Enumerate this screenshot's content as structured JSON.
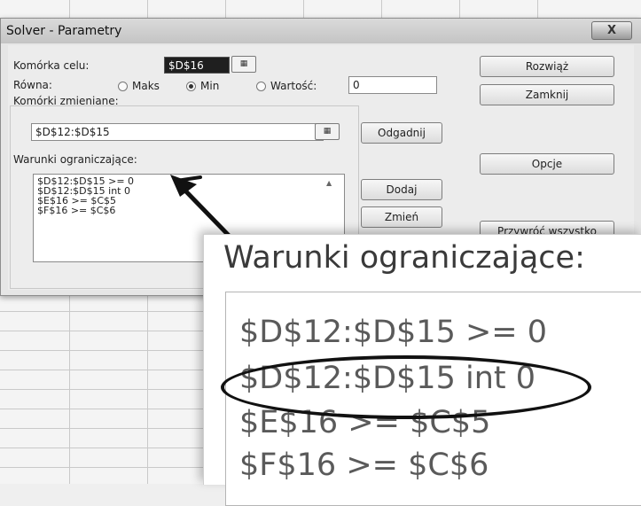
{
  "dialog": {
    "title": "Solver - Parametry",
    "close_label": "X"
  },
  "target": {
    "label": "Komórka celu:",
    "value": "$D$16"
  },
  "equal": {
    "label": "Równa:",
    "options": [
      "Maks",
      "Min",
      "Wartość:"
    ],
    "selected": "Min",
    "value": "0"
  },
  "changing": {
    "label": "Komórki zmieniane:",
    "value": "$D$12:$D$15"
  },
  "constraints": {
    "label": "Warunki ograniczające:",
    "items": [
      "$D$12:$D$15 >= 0",
      "$D$12:$D$15 int 0",
      "$E$16 >= $C$5",
      "$F$16 >= $C$6"
    ]
  },
  "buttons": {
    "solve": "Rozwiąż",
    "close": "Zamknij",
    "guess": "Odgadnij",
    "options": "Opcje",
    "add": "Dodaj",
    "change": "Zmień",
    "reset": "Przywróć wszystko"
  },
  "zoom": {
    "heading": "Warunki ograniczające:",
    "lines": [
      "$D$12:$D$15 >= 0",
      "$D$12:$D$15 int 0",
      "$E$16 >= $C$5",
      "$F$16 >= $C$6"
    ]
  }
}
